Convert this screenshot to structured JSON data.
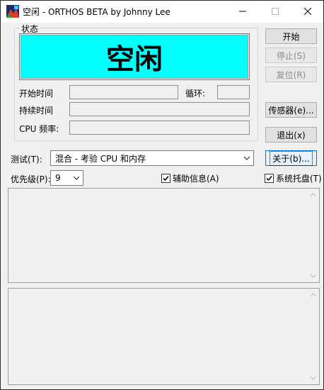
{
  "window": {
    "title": "空闲 - ORTHOS BETA by Johnny Lee",
    "icons": {
      "app": "orthos-app-icon",
      "minimize": "minimize-icon",
      "maximize": "maximize-icon",
      "close": "close-icon"
    }
  },
  "status": {
    "group_label": "状态",
    "display": "空闲",
    "display_color": "#00ffff",
    "start_time_label": "开始时间",
    "start_time_value": "",
    "loop_label": "循环:",
    "loop_value": "",
    "duration_label": "持续时间",
    "duration_value": "",
    "cpu_freq_label": "CPU 频率:",
    "cpu_freq_value": ""
  },
  "buttons": {
    "start": "开始",
    "stop": "停止(S)",
    "reset": "复位(R)",
    "sensors": "传感器(e)...",
    "exit": "退出(x)",
    "about": "关于(b)..."
  },
  "test": {
    "label": "测试(T):",
    "selected": "混合 - 考验 CPU 和内存"
  },
  "priority": {
    "label": "优先级(P):",
    "selected": "9"
  },
  "options": {
    "aux_info_label": "辅助信息(A)",
    "aux_info_checked": true,
    "tray_label": "系统托盘(T)",
    "tray_checked": true
  },
  "accent_color": "#0078d7"
}
